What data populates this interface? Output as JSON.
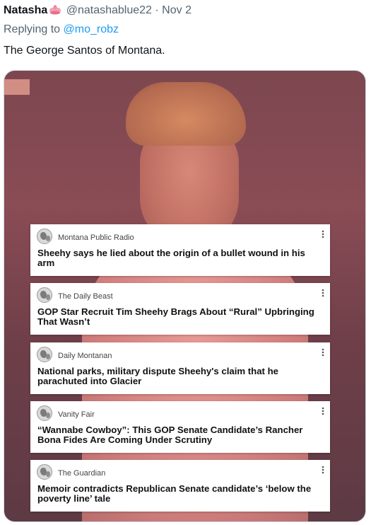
{
  "tweet": {
    "author_name": "Natasha",
    "author_emoji": "lotus-flower-icon",
    "handle": "@natashablue22",
    "separator": "·",
    "date": "Nov 2",
    "replying_prefix": "Replying to",
    "replying_to": "@mo_robz",
    "text": "The George Santos of Montana."
  },
  "colors": {
    "link": "#1d9bf0",
    "meta": "#536471",
    "photo_tint": "#8a4c55"
  },
  "media": {
    "cards": [
      {
        "source": "Montana Public Radio",
        "headline": "Sheehy says he lied about the origin of a bullet wound in his arm",
        "menu_icon": "more-vertical-icon"
      },
      {
        "source": "The Daily Beast",
        "headline": "GOP Star Recruit Tim Sheehy Brags About “Rural” Upbringing That Wasn’t",
        "menu_icon": "more-vertical-icon"
      },
      {
        "source": "Daily Montanan",
        "headline": "National parks, military dispute Sheehy's claim that he parachuted into Glacier",
        "menu_icon": "more-vertical-icon"
      },
      {
        "source": "Vanity Fair",
        "headline": "“Wannabe Cowboy”: This GOP Senate Candidate’s Rancher Bona Fides Are Coming Under Scrutiny",
        "menu_icon": "more-vertical-icon"
      },
      {
        "source": "The Guardian",
        "headline": "Memoir contradicts Republican Senate candidate’s ‘below the poverty line’ tale",
        "menu_icon": "more-vertical-icon"
      }
    ]
  }
}
